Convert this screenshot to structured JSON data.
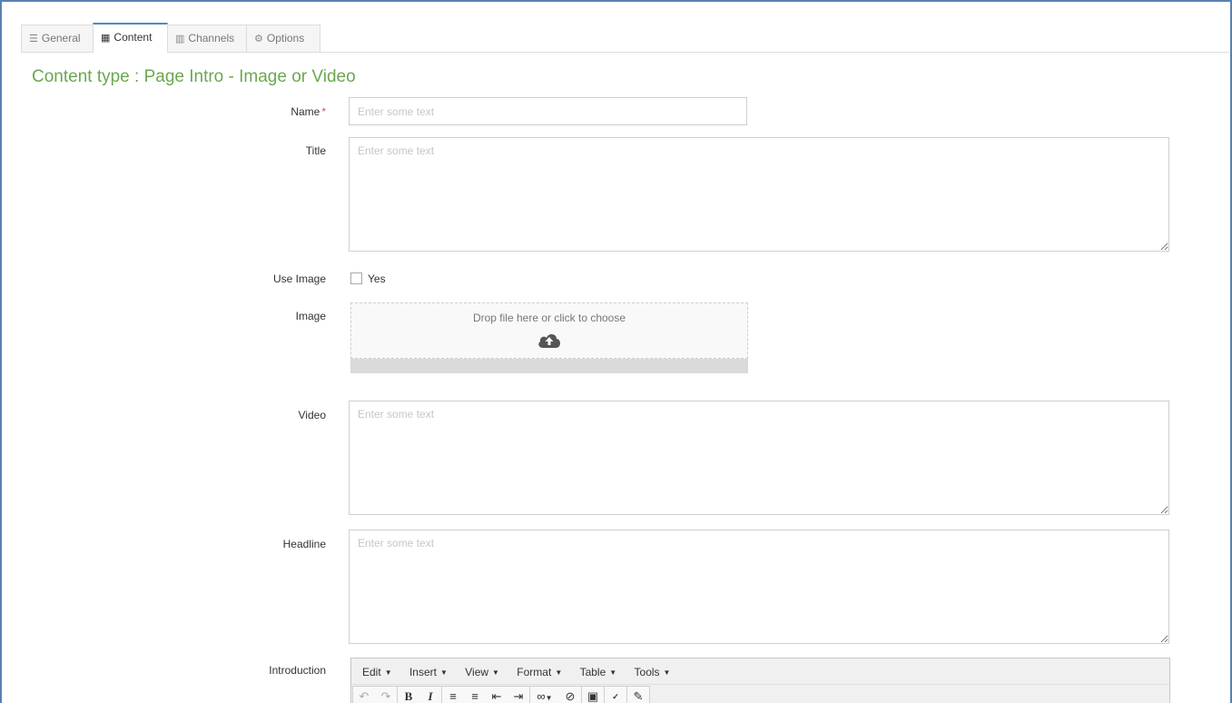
{
  "tabs": [
    {
      "label": "General",
      "icon": "sliders-icon"
    },
    {
      "label": "Content",
      "icon": "cubes-icon"
    },
    {
      "label": "Channels",
      "icon": "sitemap-icon"
    },
    {
      "label": "Options",
      "icon": "gears-icon"
    }
  ],
  "active_tab": "Content",
  "content_title": "Content type : Page Intro - Image or Video",
  "form": {
    "name": {
      "label": "Name",
      "required_mark": "*",
      "placeholder": "Enter some text",
      "value": ""
    },
    "title": {
      "label": "Title",
      "placeholder": "Enter some text",
      "value": ""
    },
    "use_image": {
      "label": "Use Image",
      "option_label": "Yes",
      "checked": false
    },
    "image": {
      "label": "Image",
      "dropzone_text": "Drop file here or click to choose"
    },
    "video": {
      "label": "Video",
      "placeholder": "Enter some text",
      "value": ""
    },
    "headline": {
      "label": "Headline",
      "placeholder": "Enter some text",
      "value": ""
    },
    "introduction": {
      "label": "Introduction"
    }
  },
  "editor": {
    "menus": [
      "Edit",
      "Insert",
      "View",
      "Format",
      "Table",
      "Tools"
    ],
    "toolbar_icons": [
      "undo-icon",
      "redo-icon",
      "bold-icon",
      "italic-icon",
      "bullet-list-icon",
      "numbered-list-icon",
      "outdent-icon",
      "indent-icon",
      "link-icon",
      "unlink-icon",
      "image-icon",
      "spellcheck-icon",
      "eraser-icon"
    ]
  },
  "colors": {
    "title_green": "#6aa84f",
    "active_tab_border": "#4c88c6",
    "frame_border": "#5b7fb3",
    "required_red": "#d9534f"
  }
}
